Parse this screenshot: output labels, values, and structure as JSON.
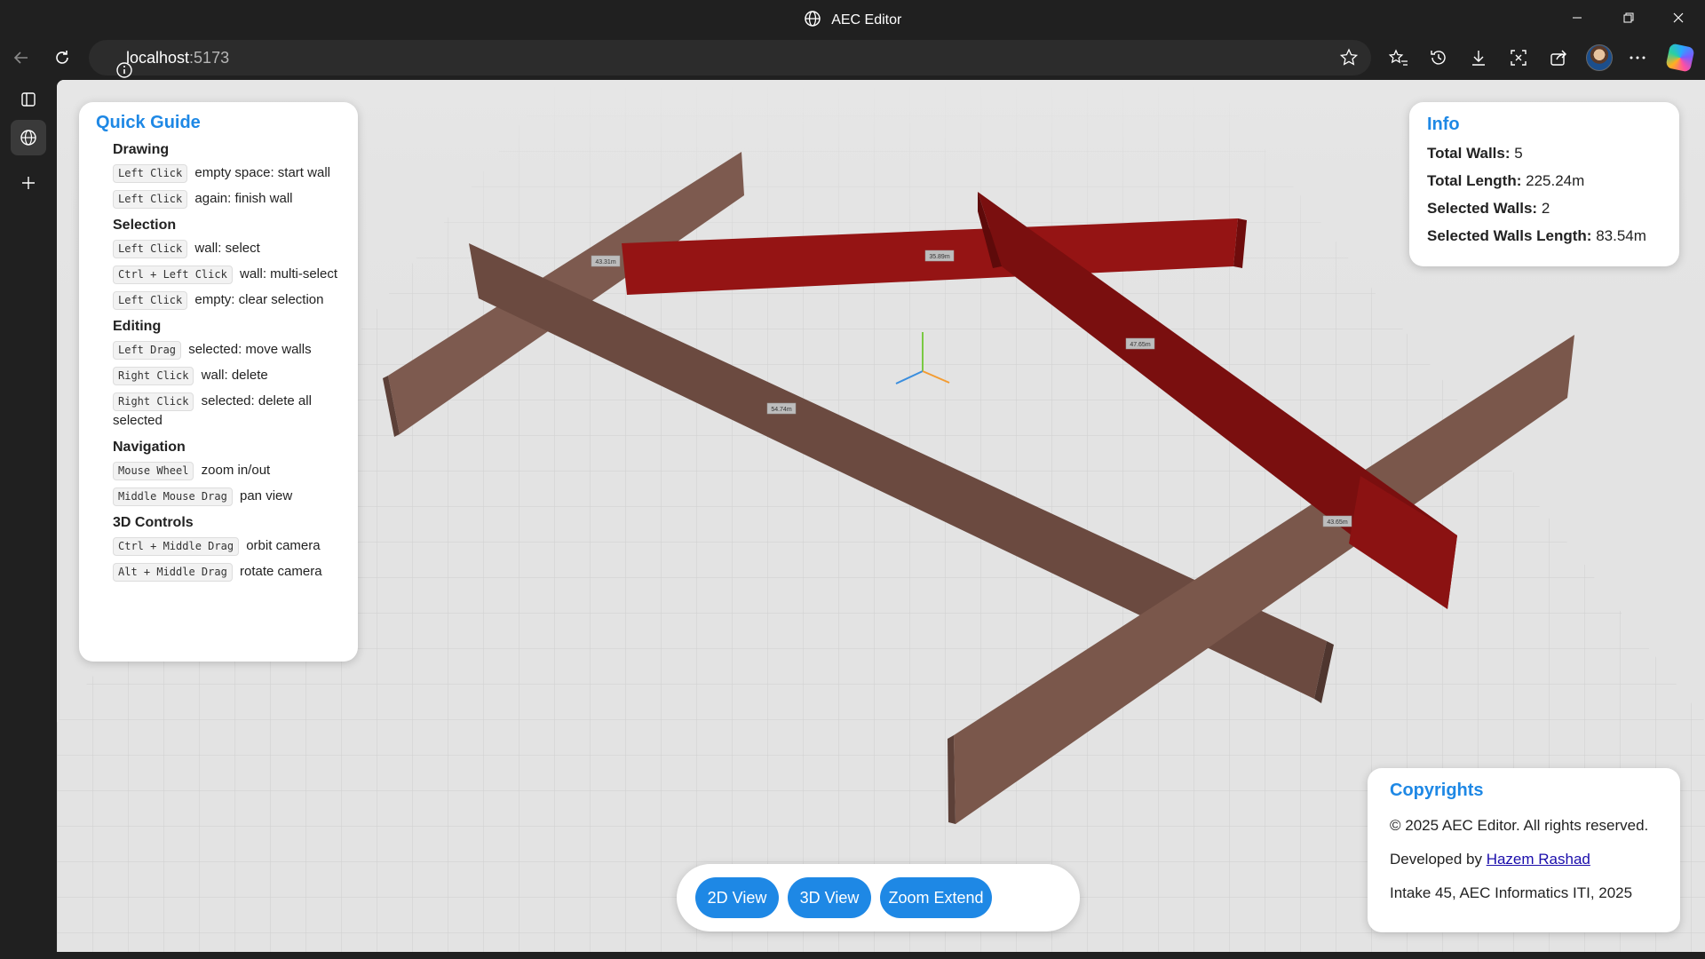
{
  "window": {
    "title": "AEC Editor"
  },
  "browser": {
    "url_host": "localhost",
    "url_port": ":5173"
  },
  "quick_guide": {
    "title": "Quick Guide",
    "sections": [
      {
        "heading": "Drawing",
        "items": [
          {
            "key": "Left Click",
            "text": "empty space: start wall"
          },
          {
            "key": "Left Click",
            "text": "again: finish wall"
          }
        ]
      },
      {
        "heading": "Selection",
        "items": [
          {
            "key": "Left Click",
            "text": "wall: select"
          },
          {
            "key": "Ctrl + Left Click",
            "text": "wall: multi-select"
          },
          {
            "key": "Left Click",
            "text": "empty: clear selection"
          }
        ]
      },
      {
        "heading": "Editing",
        "items": [
          {
            "key": "Left Drag",
            "text": "selected: move walls"
          },
          {
            "key": "Right Click",
            "text": "wall: delete"
          },
          {
            "key": "Right Click",
            "text": "selected: delete all selected"
          }
        ]
      },
      {
        "heading": "Navigation",
        "items": [
          {
            "key": "Mouse Wheel",
            "text": "zoom in/out"
          },
          {
            "key": "Middle Mouse Drag",
            "text": "pan view"
          }
        ]
      },
      {
        "heading": "3D Controls",
        "items": [
          {
            "key": "Ctrl + Middle Drag",
            "text": "orbit camera"
          },
          {
            "key": "Alt + Middle Drag",
            "text": "rotate camera"
          }
        ]
      }
    ]
  },
  "info": {
    "title": "Info",
    "total_walls_label": "Total Walls:",
    "total_walls": "5",
    "total_length_label": "Total Length:",
    "total_length": "225.24m",
    "selected_walls_label": "Selected Walls:",
    "selected_walls": "2",
    "selected_length_label": "Selected Walls Length:",
    "selected_length": "83.54m"
  },
  "copyrights": {
    "title": "Copyrights",
    "line1": "© 2025 AEC Editor. All rights reserved.",
    "developed_by": "Developed by",
    "author": "Hazem Rashad",
    "line3": "Intake 45, AEC Informatics ITI, 2025"
  },
  "view_buttons": {
    "view2d": "2D View",
    "view3d": "3D View",
    "zoom_extend": "Zoom Extend"
  },
  "wall_labels": [
    "43.31m",
    "35.89m",
    "47.65m",
    "54.74m",
    "43.65m"
  ],
  "colors": {
    "accent": "#1e88e5",
    "wall": "#6b4a40",
    "selected_wall": "#8e1212",
    "ground": "#e3e3e3"
  },
  "icons": {
    "back": "arrow-left-icon",
    "refresh": "refresh-icon",
    "info": "info-icon",
    "favorite": "star-icon"
  }
}
